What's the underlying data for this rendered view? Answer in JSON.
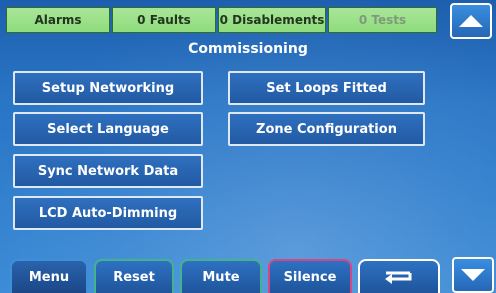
{
  "status_bar": {
    "alarms": "Alarms",
    "faults": "0 Faults",
    "disablements": "0 Disablements",
    "tests": "0 Tests"
  },
  "section_title": "Commissioning",
  "menu_buttons": [
    "Setup Networking",
    "Set Loops Fitted",
    "Select Language",
    "Zone Configuration",
    "Sync Network Data",
    "LCD Auto-Dimming"
  ],
  "tabs": {
    "menu": "Menu",
    "reset": "Reset",
    "mute": "Mute",
    "silence": "Silence"
  },
  "icons": {
    "scroll_up": "triangle-up-icon",
    "scroll_down": "triangle-down-icon",
    "return": "return-arrow-icon"
  },
  "colors": {
    "status_green": "#8fdc7d",
    "screen_blue": "#2a76c6",
    "silence_border": "#d24784",
    "tab_border": "#43b38e"
  }
}
